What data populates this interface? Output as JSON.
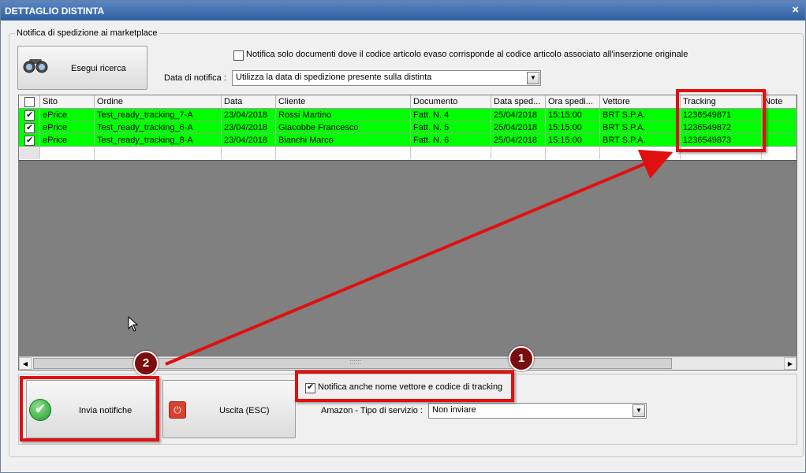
{
  "window": {
    "title": "DETTAGLIO DISTINTA",
    "close": "×"
  },
  "group": {
    "label": "Notifica di spedizione ai marketplace"
  },
  "search_button": {
    "label": "Esegui ricerca"
  },
  "match_option": {
    "label": "Notifica solo documenti dove il codice articolo evaso corrisponde al codice articolo associato all'inserzione originale",
    "checked": false
  },
  "notify_date": {
    "label": "Data di notifica :",
    "value": "Utilizza la data di spedizione presente sulla distinta"
  },
  "grid": {
    "headers": [
      "Sito",
      "Ordine",
      "Data",
      "Cliente",
      "Documento",
      "Data sped...",
      "Ora spedi...",
      "Vettore",
      "Tracking",
      "Note"
    ],
    "rows": [
      {
        "sito": "ePrice",
        "ordine": "Test_ready_tracking_7-A",
        "data": "23/04/2018",
        "cliente": "Rossi Martino",
        "documento": "Fatt. N. 4",
        "data_sped": "25/04/2018",
        "ora_sped": "15:15:00",
        "vettore": "BRT S.P.A.",
        "tracking": "1236549871",
        "note": ""
      },
      {
        "sito": "ePrice",
        "ordine": "Test_ready_tracking_6-A",
        "data": "23/04/2018",
        "cliente": "Giacobbe Francesco",
        "documento": "Fatt. N. 5",
        "data_sped": "25/04/2018",
        "ora_sped": "15:15:00",
        "vettore": "BRT S.P.A.",
        "tracking": "1236549872",
        "note": ""
      },
      {
        "sito": "ePrice",
        "ordine": "Test_ready_tracking_8-A",
        "data": "23/04/2018",
        "cliente": "Bianchi Marco",
        "documento": "Fatt. N. 6",
        "data_sped": "25/04/2018",
        "ora_sped": "15:15:00",
        "vettore": "BRT S.P.A.",
        "tracking": "1236549873",
        "note": ""
      }
    ],
    "row_highlight": "#00ff00"
  },
  "scroll": {
    "handle": "::::::"
  },
  "send_button": {
    "label": "Invia notifiche"
  },
  "exit_button": {
    "label": "Uscita (ESC)"
  },
  "carrier_option": {
    "label": "Notifica anche nome vettore e codice di tracking",
    "checked": true
  },
  "amazon": {
    "label": "Amazon - Tipo di servizio :",
    "value": "Non inviare"
  },
  "annotations": {
    "badge_1": "1",
    "badge_2": "2",
    "color": "#e01010"
  }
}
